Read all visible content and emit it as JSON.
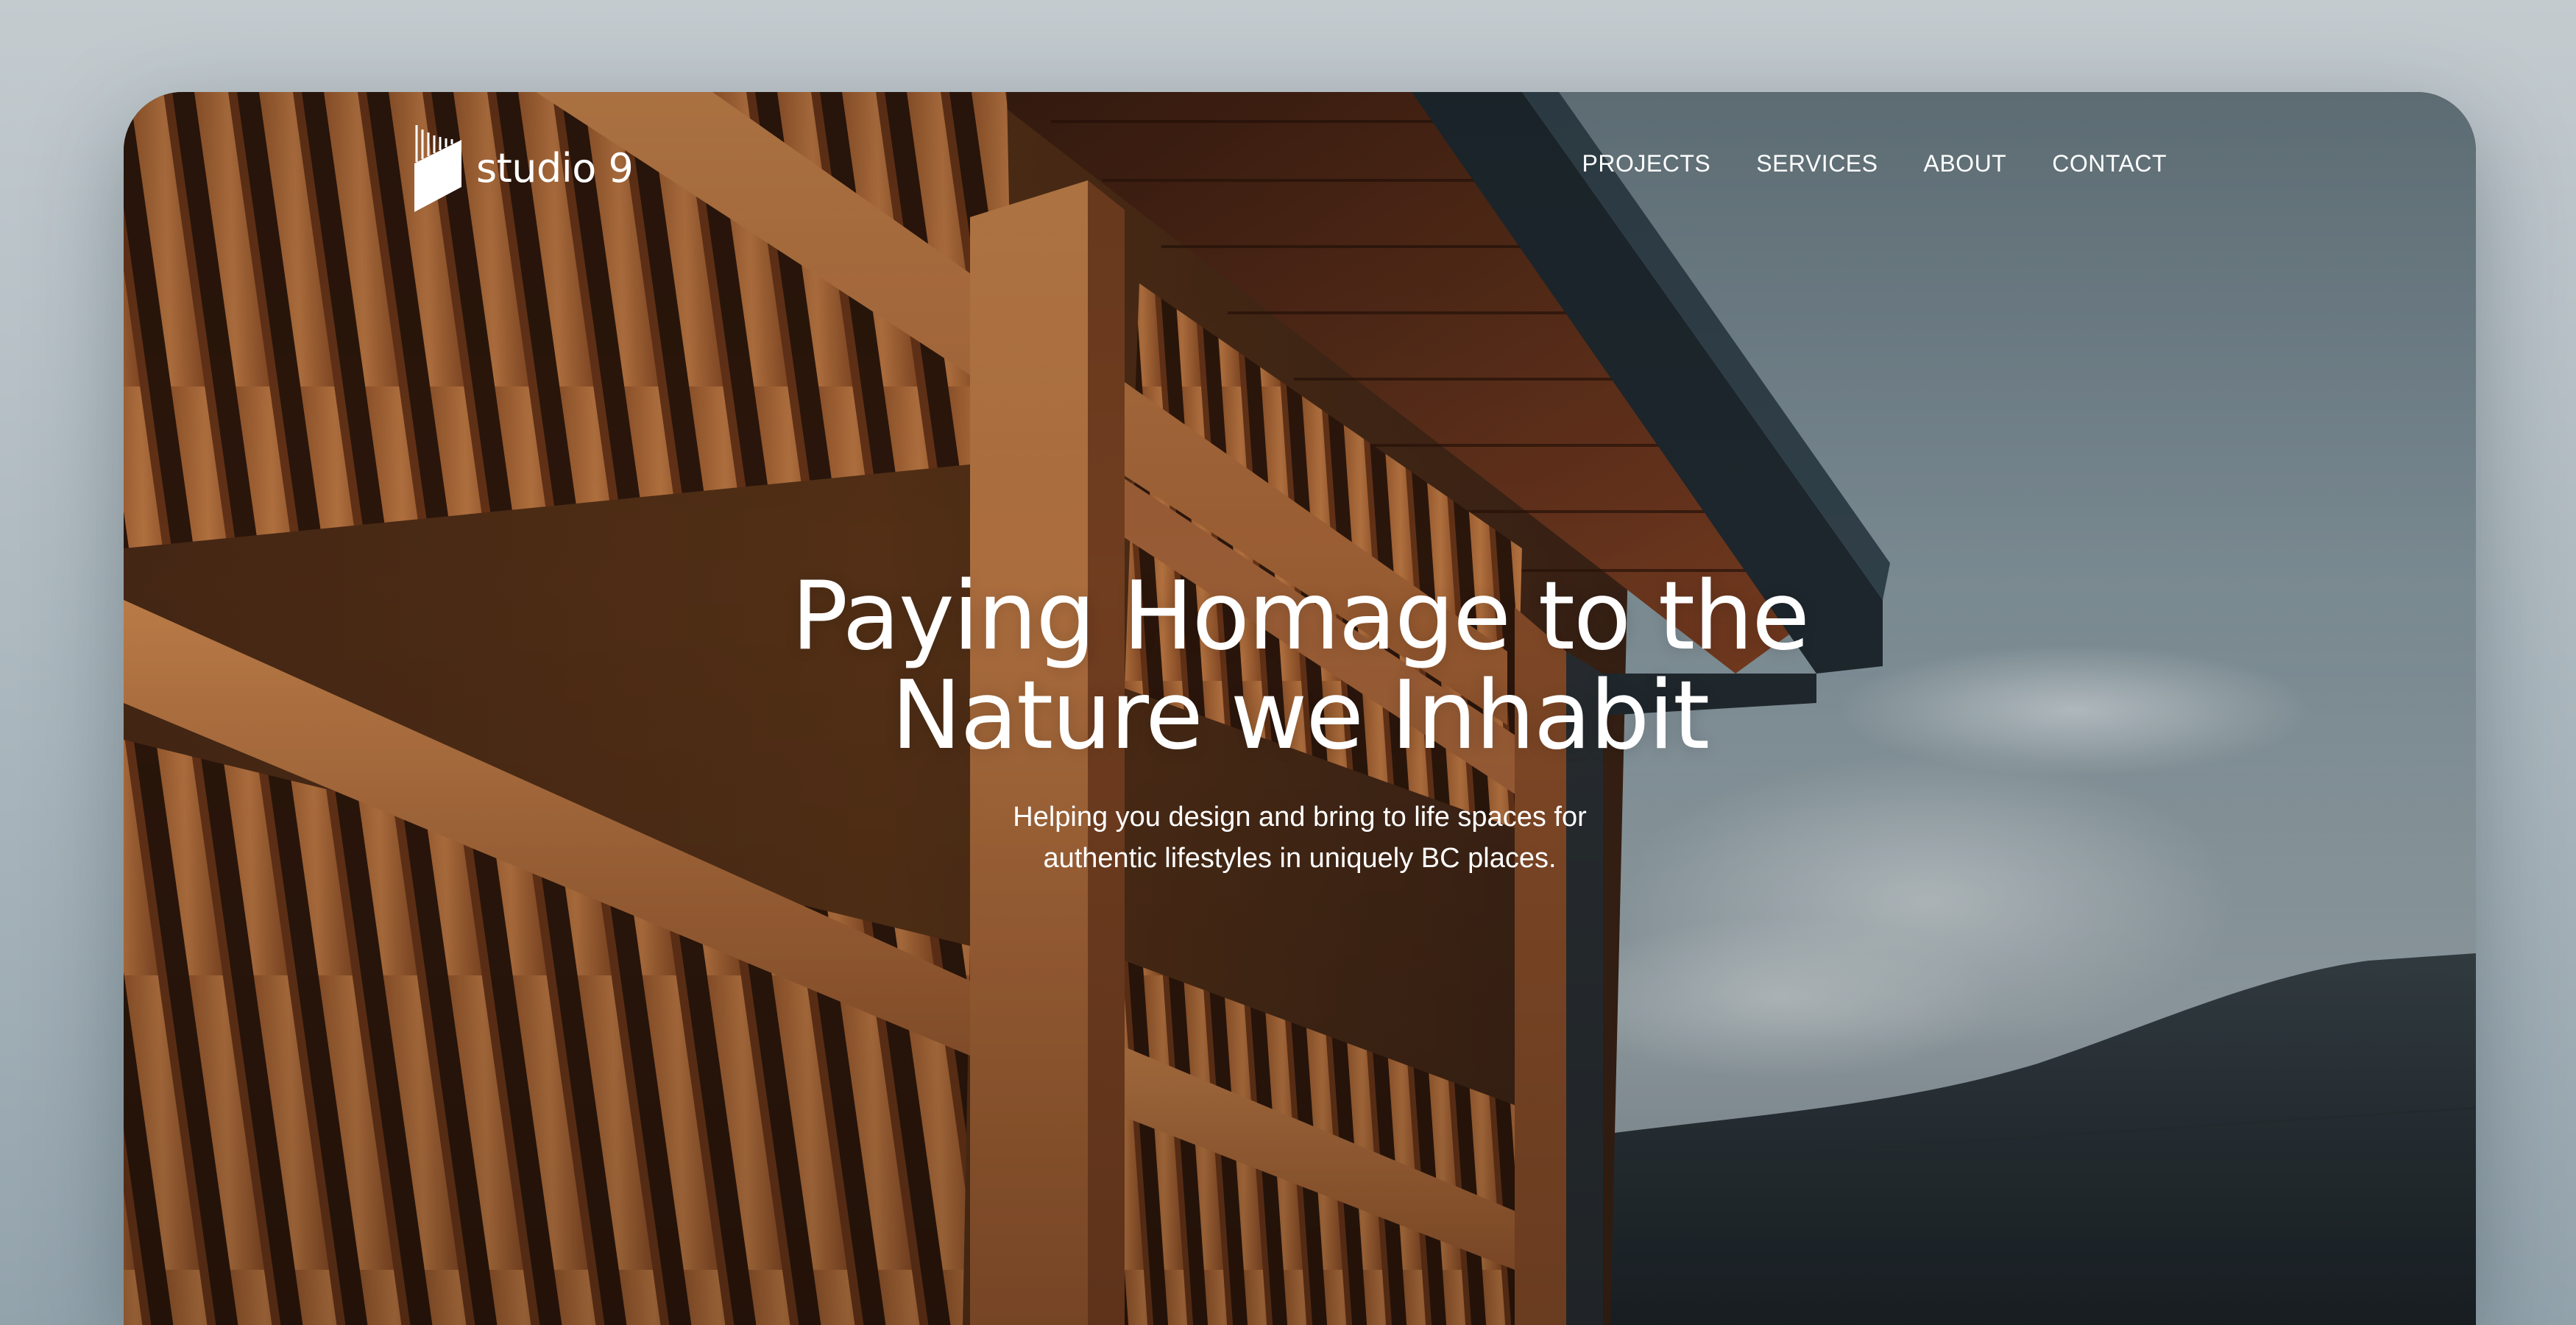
{
  "brand": {
    "name": "studio 9",
    "logo_icon": "studio9-logo-icon"
  },
  "nav": {
    "items": [
      {
        "label": "PROJECTS"
      },
      {
        "label": "SERVICES"
      },
      {
        "label": "ABOUT"
      },
      {
        "label": "CONTACT"
      }
    ]
  },
  "hero": {
    "title_lines": [
      "Paying Homage to the",
      "Nature we Inhabit"
    ],
    "subtitle_lines": [
      "Helping you design and bring to life spaces for",
      "authentic lifestyles in uniquely BC places."
    ],
    "image": "timber-slat-building-photo"
  },
  "colors": {
    "page_background": "#b7c1c6",
    "text": "#ffffff",
    "wood": "#b06a3a",
    "sky": "#7f929b",
    "mountain": "#263036"
  }
}
